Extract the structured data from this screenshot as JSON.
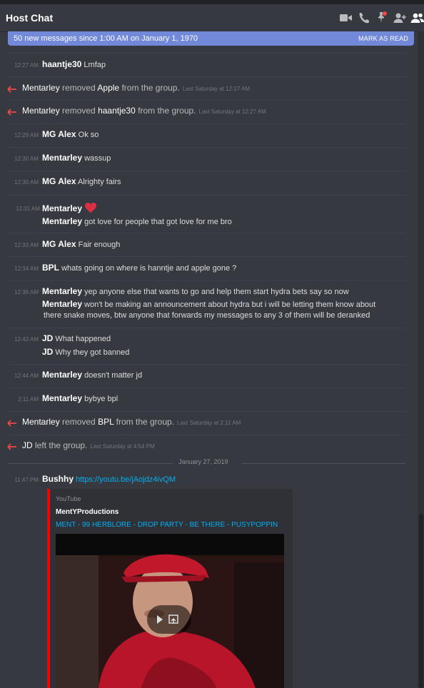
{
  "header": {
    "title": "Host Chat",
    "icons": [
      "video-call-icon",
      "voice-call-icon",
      "pinned-messages-icon",
      "add-friend-icon",
      "member-list-icon"
    ]
  },
  "banner": {
    "text": "50 new messages since 1:00 AM on January 1, 1970",
    "action": "MARK AS READ"
  },
  "messages": [
    {
      "time": "12:27 AM",
      "author": "haantje30",
      "text": "Lmfap"
    },
    {
      "actor": "Mentarley",
      "action": "removed",
      "target": "Apple",
      "suffix": "from the group.",
      "time": "Last Saturday at 12:27 AM"
    },
    {
      "actor": "Mentarley",
      "action": "removed",
      "target": "haantje30",
      "suffix": "from the group.",
      "time": "Last Saturday at 12:27 AM"
    },
    {
      "time": "12:29 AM",
      "author": "MG Alex",
      "text": "Ok so"
    },
    {
      "time": "12:30 AM",
      "author": "Mentarley",
      "text": "wassup"
    },
    {
      "time": "12:30 AM",
      "author": "MG Alex",
      "text": "Alrighty fairs"
    },
    {
      "time": "12:31 AM",
      "author": "Mentarley",
      "emoji": "heart-emoji",
      "cont_author": "Mentarley",
      "cont_text": "got love for people that got love for me bro"
    },
    {
      "time": "12:33 AM",
      "author": "MG Alex",
      "text": "Fair enough"
    },
    {
      "time": "12:34 AM",
      "author": "BPL",
      "text": "whats going on where is hanntje and apple gone ?"
    },
    {
      "time": "12:36 AM",
      "author": "Mentarley",
      "text": "yep anyone else that wants to go and help them start hydra bets say so now",
      "cont_author": "Mentarley",
      "cont_text": "won't be making an announcement about hydra but i will be letting them know about",
      "cont_text2": "there snake moves, btw anyone that forwards my messages to any 3 of them will be deranked"
    },
    {
      "time": "12:43 AM",
      "author": "JD",
      "text": "What happened",
      "cont_author": "JD",
      "cont_text": "Why they got banned"
    },
    {
      "time": "12:44 AM",
      "author": "Mentarley",
      "text": "doesn't matter jd"
    },
    {
      "time": "2:11 AM",
      "author": "Mentarley",
      "text": "bybye bpl"
    },
    {
      "actor": "Mentarley",
      "action": "removed",
      "target": "BPL",
      "suffix": "from the group.",
      "time": "Last Saturday at 2:11 AM"
    },
    {
      "actor": "JD",
      "action": "left the group.",
      "time": "Last Saturday at 4:54 PM"
    }
  ],
  "date_separator": "January 27, 2019",
  "last_message": {
    "time": "11:47 PM",
    "author": "Bushhy",
    "link": "https://youtu.be/jAojdz4ivQM",
    "embed": {
      "provider": "YouTube",
      "author": "MentYProductions",
      "title": "MENT - 99 HERBLORE - DROP PARTY - BE THERE - PUSYPOPPIN",
      "accent": "#ff0000"
    }
  },
  "colors": {
    "background": "#36393f",
    "banner": "#7289da",
    "link": "#00b0f4",
    "system_arrow": "#f04747"
  }
}
